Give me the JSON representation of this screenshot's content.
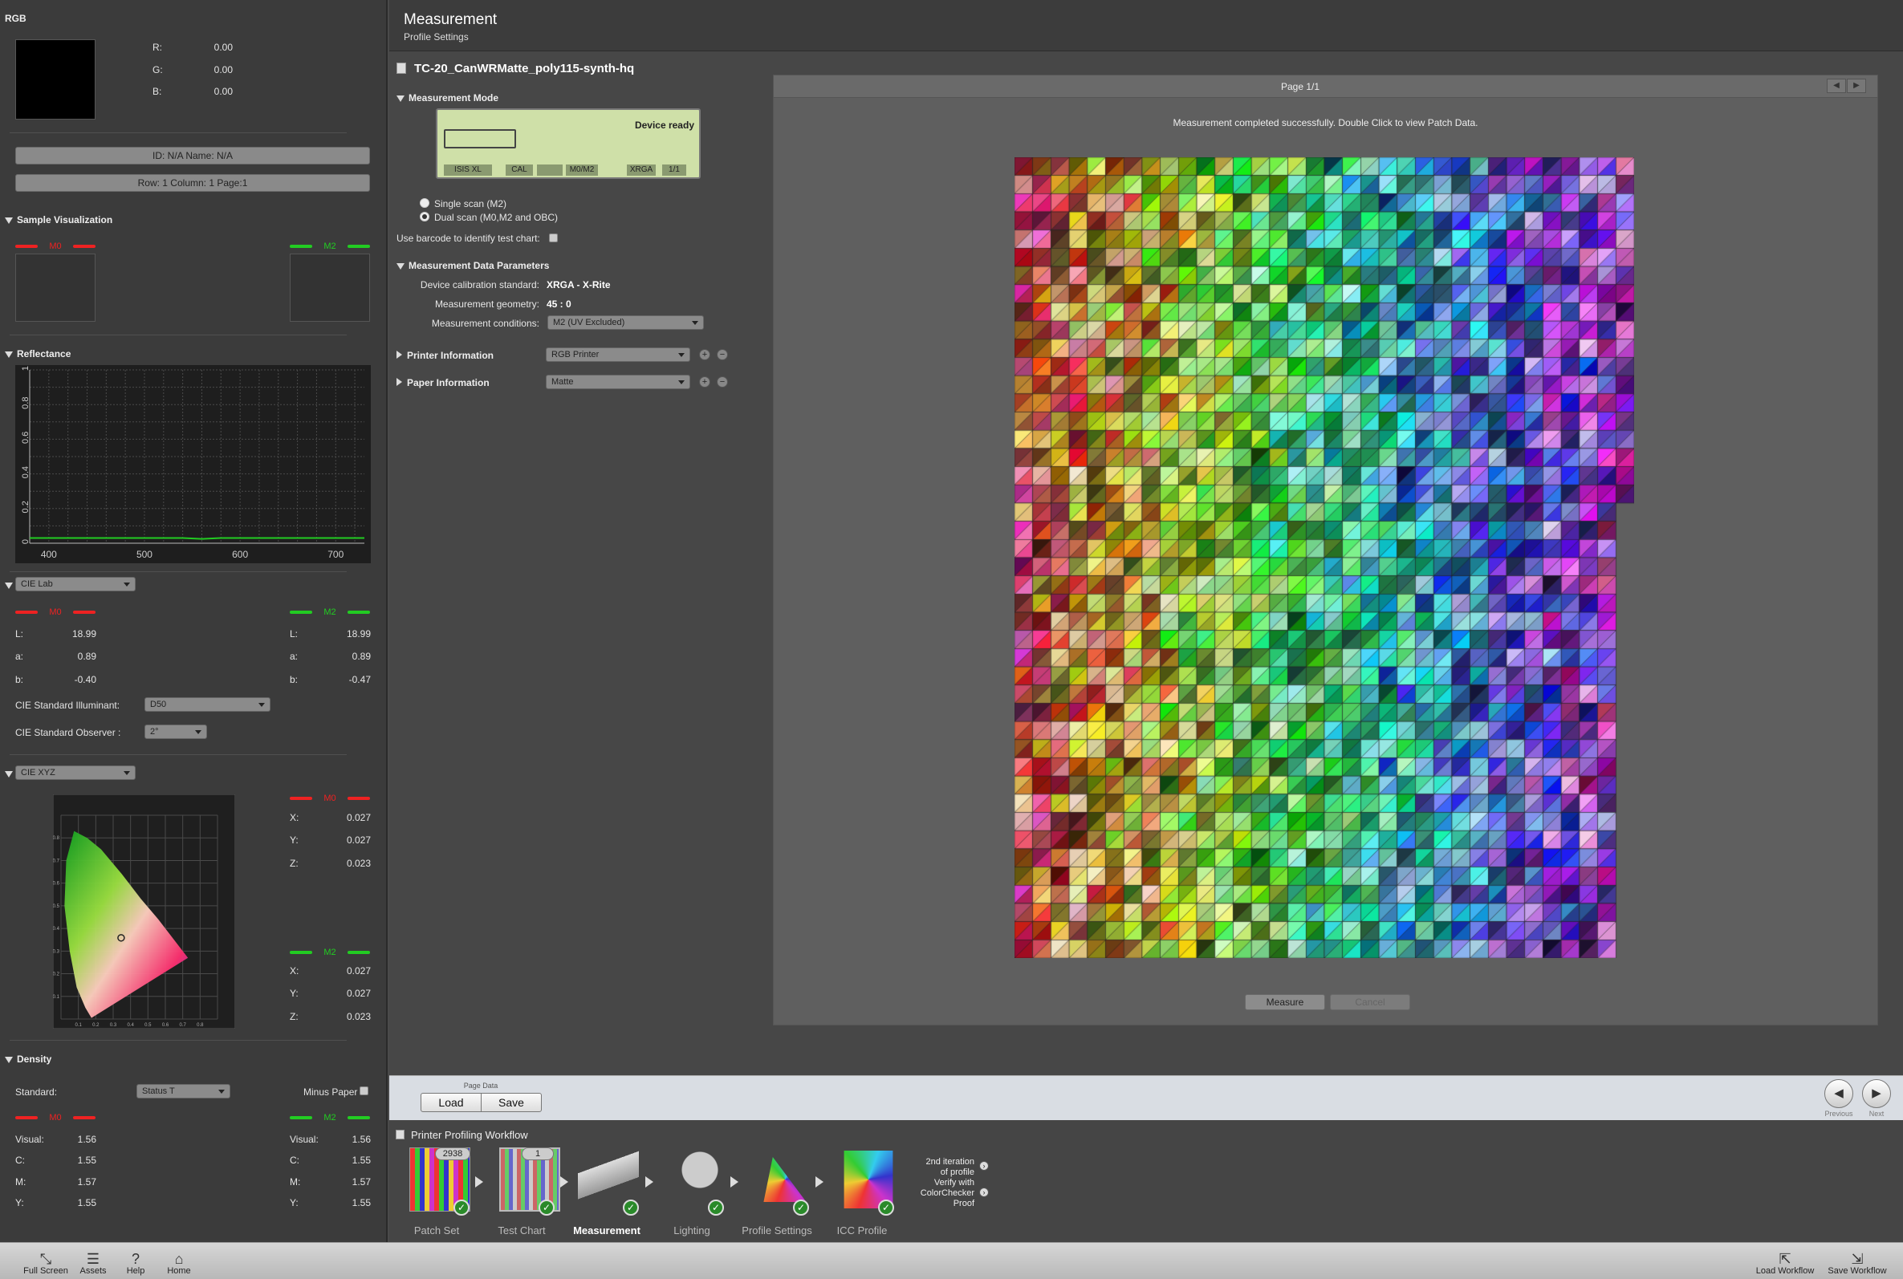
{
  "left": {
    "rgb": {
      "title": "RGB",
      "labels": [
        "R:",
        "G:",
        "B:"
      ],
      "values": [
        "0.00",
        "0.00",
        "0.00"
      ],
      "id_name": "ID: N/A    Name: N/A",
      "row_col": "Row: 1    Column: 1    Page:1"
    },
    "sample": {
      "title": "Sample Visualization",
      "m0": "M0",
      "m2": "M2"
    },
    "reflectance": {
      "title": "Reflectance"
    },
    "cielab": {
      "dropdown": "CIE Lab",
      "m0": "M0",
      "m2": "M2",
      "labels": [
        "L:",
        "a:",
        "b:"
      ],
      "m0_values": [
        "18.99",
        "0.89",
        "-0.40"
      ],
      "m2_values": [
        "18.99",
        "0.89",
        "-0.47"
      ],
      "illuminant_label": "CIE Standard Illuminant:",
      "illuminant_value": "D50",
      "observer_label": "CIE Standard Observer :",
      "observer_value": "2°"
    },
    "ciexyz": {
      "dropdown": "CIE XYZ",
      "m0": "M0",
      "m2": "M2",
      "labels": [
        "X:",
        "Y:",
        "Z:"
      ],
      "m0_values": [
        "0.027",
        "0.027",
        "0.023"
      ],
      "m2_values": [
        "0.027",
        "0.027",
        "0.023"
      ]
    },
    "density": {
      "title": "Density",
      "standard_label": "Standard:",
      "standard_value": "Status T",
      "minus_paper": "Minus Paper",
      "m0": "M0",
      "m2": "M2",
      "labels": [
        "Visual:",
        "C:",
        "M:",
        "Y:"
      ],
      "m0_values": [
        "1.56",
        "1.55",
        "1.57",
        "1.55"
      ],
      "m2_values": [
        "1.56",
        "1.55",
        "1.57",
        "1.55"
      ]
    }
  },
  "chart_data": {
    "type": "line",
    "title": "Reflectance",
    "x": [
      380,
      400,
      420,
      440,
      460,
      480,
      500,
      520,
      540,
      560,
      580,
      600,
      620,
      640,
      660,
      680,
      700,
      720,
      730
    ],
    "series": [
      {
        "values": [
          0.03,
          0.03,
          0.03,
          0.03,
          0.03,
          0.03,
          0.03,
          0.03,
          0.03,
          0.025,
          0.03,
          0.03,
          0.03,
          0.03,
          0.03,
          0.03,
          0.03,
          0.03,
          0.03
        ]
      }
    ],
    "xlim": [
      380,
      730
    ],
    "ylim": [
      0,
      1
    ],
    "xticks": [
      400,
      500,
      600,
      700
    ],
    "yticks": [
      "0",
      "0.2",
      "0.4",
      "0.6",
      "0.8",
      "1"
    ],
    "grid": true,
    "line_color": "#22cc22"
  },
  "chromaticity": {
    "xticks": [
      "0.1",
      "0.2",
      "0.3",
      "0.4",
      "0.5",
      "0.6",
      "0.7",
      "0.8"
    ],
    "yticks": [
      "0.1",
      "0.2",
      "0.3",
      "0.4",
      "0.5",
      "0.6",
      "0.7",
      "0.8"
    ]
  },
  "header": {
    "title": "Measurement",
    "subtitle": "Profile Settings"
  },
  "file": {
    "name": "TC-20_CanWRMatte_poly115-synth-hq"
  },
  "mode": {
    "title": "Measurement Mode",
    "device_status": "Device ready",
    "lcd_items": [
      "ISIS XL",
      "CAL",
      "M0/M2",
      "XRGA",
      "1/1"
    ],
    "single_scan": "Single scan (M2)",
    "dual_scan": "Dual scan (M0,M2 and OBC)",
    "barcode": "Use barcode to identify test chart:"
  },
  "params": {
    "title": "Measurement Data Parameters",
    "calib_label": "Device calibration standard:",
    "calib_value": "XRGA - X-Rite",
    "geom_label": "Measurement geometry:",
    "geom_value": "45 : 0",
    "cond_label": "Measurement conditions:",
    "cond_value": "M2 (UV Excluded)"
  },
  "printer": {
    "label": "Printer Information",
    "value": "RGB Printer"
  },
  "paper": {
    "label": "Paper Information",
    "value": "Matte"
  },
  "panel": {
    "page": "Page 1/1",
    "status": "Measurement completed successfully. Double Click to view Patch Data.",
    "measure": "Measure",
    "cancel": "Cancel"
  },
  "pagedata": {
    "title": "Page Data",
    "load": "Load",
    "save": "Save",
    "previous": "Previous",
    "next": "Next"
  },
  "workflow": {
    "title": "Printer Profiling Workflow",
    "patch_count": "2938",
    "page_count": "1",
    "steps": [
      "Patch Set",
      "Test Chart",
      "Measurement",
      "Lighting",
      "Profile Settings",
      "ICC Profile"
    ],
    "note_lines": [
      "2nd iteration",
      "of profile",
      "Verify with",
      "ColorChecker",
      "Proof"
    ]
  },
  "bottom": {
    "full_screen": "Full Screen",
    "assets": "Assets",
    "help": "Help",
    "home": "Home",
    "load_workflow": "Load Workflow",
    "save_workflow": "Save Workflow"
  },
  "colors": {
    "m0": "#ee2222",
    "m2": "#22cc22",
    "accent": "#cfe0a8"
  }
}
